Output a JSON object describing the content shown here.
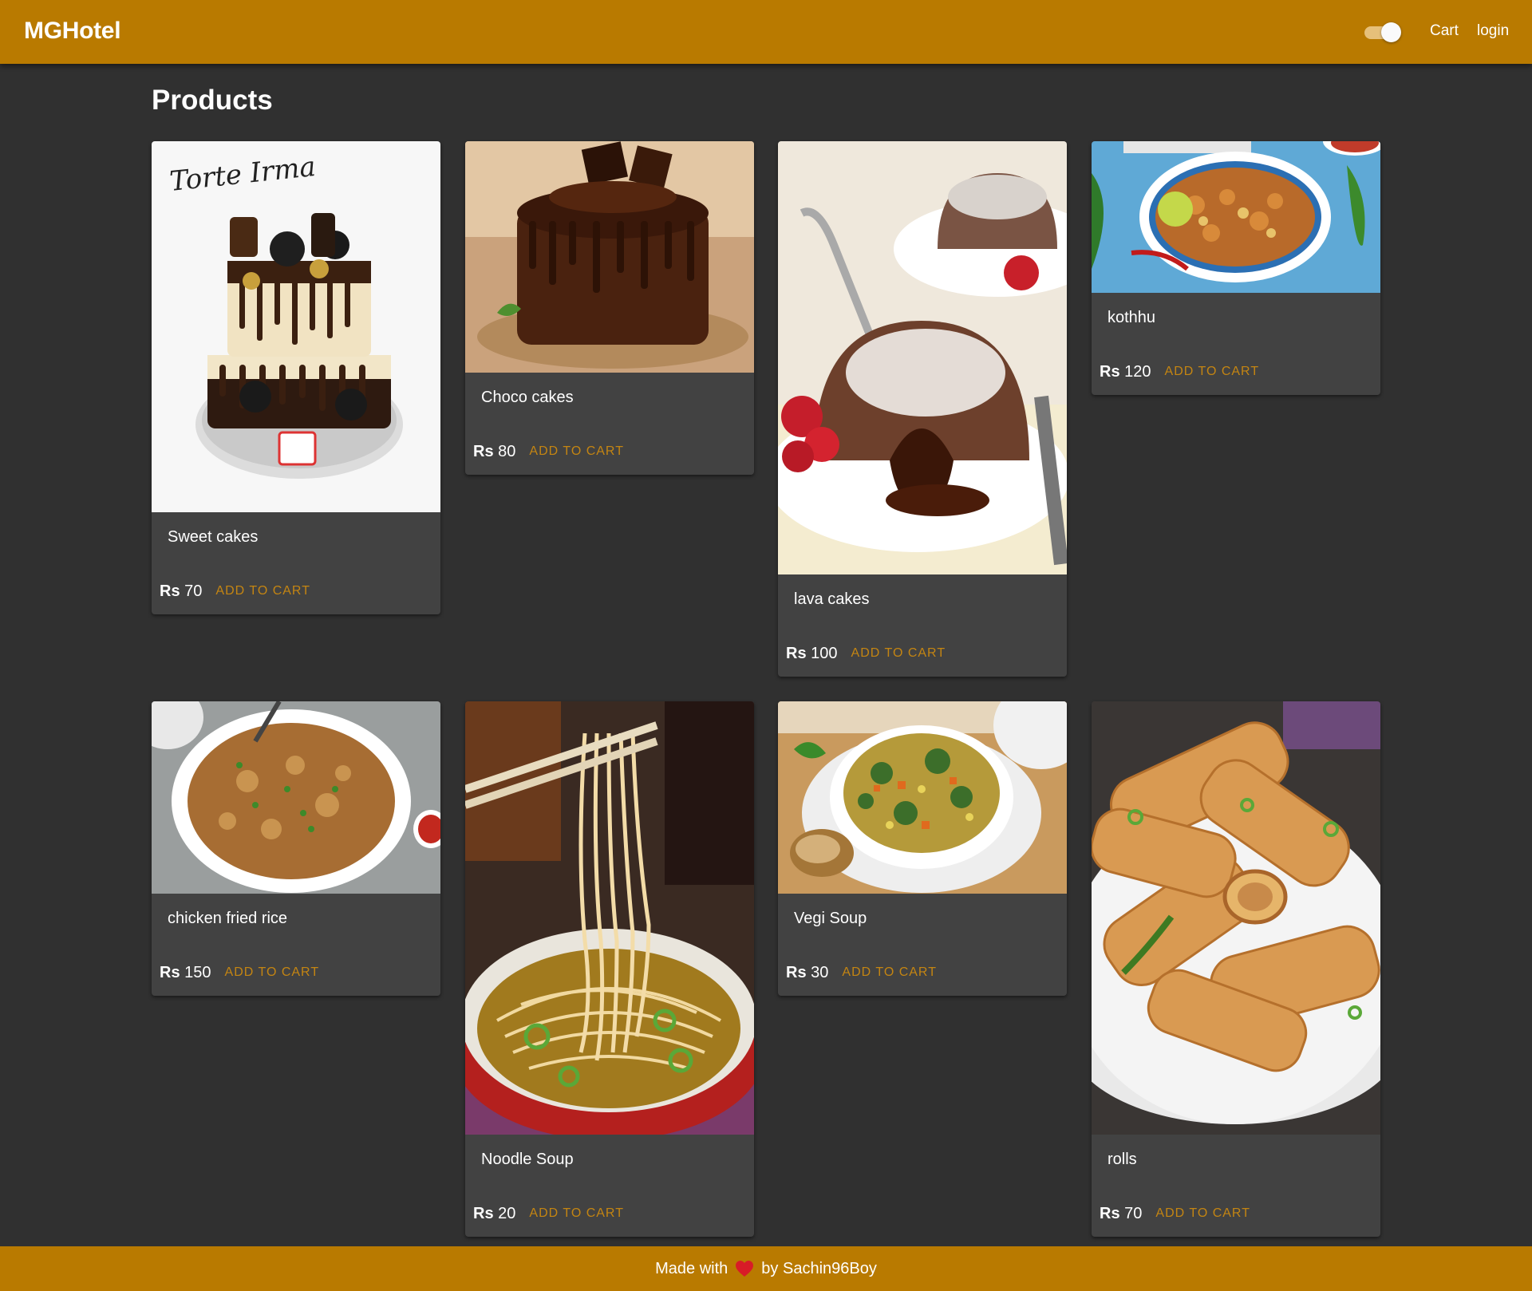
{
  "appbar": {
    "brand": "MGHotel",
    "theme_toggle": {
      "checked": true
    },
    "cart_label": "Cart",
    "login_label": "login"
  },
  "page_title": "Products",
  "currency": "Rs",
  "add_to_cart_label": "ADD TO CART",
  "products": [
    {
      "name": "Sweet cakes",
      "price": "70",
      "image_text": "Torte Irma",
      "image": "tiered-cake-photo"
    },
    {
      "name": "Choco cakes",
      "price": "80",
      "image": "chocolate-cake-photo"
    },
    {
      "name": "lava cakes",
      "price": "100",
      "image": "lava-cake-photo"
    },
    {
      "name": "kothhu",
      "price": "120",
      "image": "kothu-photo"
    },
    {
      "name": "chicken fried rice",
      "price": "150",
      "image": "fried-rice-photo"
    },
    {
      "name": "Noodle Soup",
      "price": "20",
      "image": "noodle-soup-photo"
    },
    {
      "name": "Vegi Soup",
      "price": "30",
      "image": "vegetable-soup-photo"
    },
    {
      "name": "rolls",
      "price": "70",
      "image": "spring-rolls-photo"
    }
  ],
  "footer": {
    "made_with": "Made with",
    "by": "by Sachin96Boy",
    "icon": "heart-icon"
  },
  "colors": {
    "appbar": "#b97a00",
    "background": "#303030",
    "card": "#424242",
    "accent": "#c48512"
  }
}
